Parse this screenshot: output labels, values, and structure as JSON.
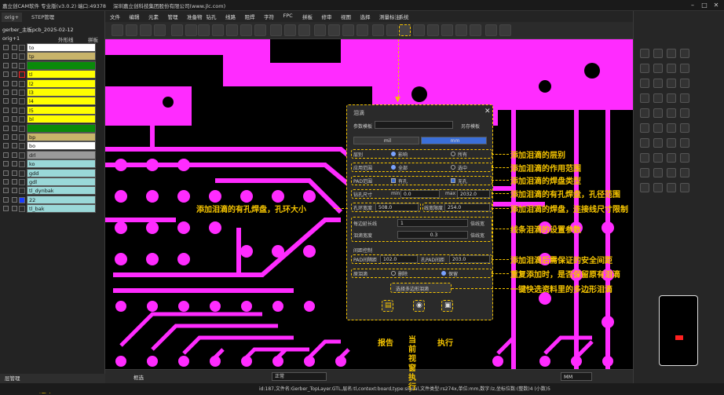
{
  "titlebar": {
    "app": "嘉立创CAM软件 专业版(v3.0.2) 端口:49378",
    "company": "深圳嘉立创科技集团股份有限公司(www.jlc.com)"
  },
  "left": {
    "tab1": "orig+",
    "tab2": "STEP管理",
    "project": "gerber_主板pcb_2025-02-12",
    "orig": "orig+1",
    "outline": "外形线",
    "panel": "拼板",
    "bottom_tab": "层管理",
    "selected": "选中:0",
    "layers": [
      {
        "name": "to",
        "color": "#ffffff"
      },
      {
        "name": "tp",
        "color": "#c8b46a"
      },
      {
        "name": "ts",
        "color": "#0a8a0a"
      },
      {
        "name": "tl",
        "color": "#ffff00"
      },
      {
        "name": "l2",
        "color": "#ffff00"
      },
      {
        "name": "l3",
        "color": "#ffff00"
      },
      {
        "name": "l4",
        "color": "#ffff00"
      },
      {
        "name": "l5",
        "color": "#ffff00"
      },
      {
        "name": "bl",
        "color": "#ffff00"
      },
      {
        "name": "bs",
        "color": "#0a8a0a"
      },
      {
        "name": "bp",
        "color": "#c8b46a"
      },
      {
        "name": "bo",
        "color": "#ffffff"
      },
      {
        "name": "drl",
        "color": "#9a9a9a"
      },
      {
        "name": "ko",
        "color": "#9ad8d8"
      },
      {
        "name": "gdd",
        "color": "#9ad8d8"
      },
      {
        "name": "gdl",
        "color": "#9ad8d8"
      },
      {
        "name": "tl_dynbak",
        "color": "#9ad8d8"
      },
      {
        "name": "22",
        "color": "#9ad8d8"
      },
      {
        "name": "tl_bak",
        "color": "#9ad8d8"
      }
    ]
  },
  "menu": [
    "文件",
    "编辑",
    "元素",
    "管理",
    "准备物",
    "钻孔",
    "线路",
    "阻焊",
    "字符",
    "FPC",
    "拼板",
    "修审",
    "视图",
    "选择",
    "测量标注",
    "系统"
  ],
  "dialog": {
    "title": "泪滴",
    "template_label": "参数模板",
    "save_template": "另存模板",
    "tab_mil": "mil",
    "tab_mm": "mm",
    "layer_label": "层别",
    "layer_cur": "影响",
    "layer_all": "所有",
    "scope_label": "应用范围",
    "scope_all": "全部",
    "scope_sel": "选中",
    "pad_label": "PAD范围",
    "pad_hole": "有孔",
    "pad_nohole": "无孔",
    "hole_label": "钻孔尺寸",
    "min_label": "min",
    "min_val": "0.0",
    "max_label": "max",
    "max_val": "2032.0",
    "ring_label": "孔环宽度",
    "ring_val": "508.0",
    "lw_label": "线宽限度",
    "lw_val": "254.0",
    "seg_label": "每边延长线",
    "seg_val": "1",
    "seg_unit": "倍线宽",
    "taper_label": "泪滴宽度",
    "taper_val": "0.3",
    "taper_unit": "倍线宽",
    "clear_title": "间距控制",
    "pad_clear": "PAD间隔距",
    "pad_clear_val": "102.0",
    "nonpad_clear": "孔PAD间距",
    "nonpad_clear_val": "203.0",
    "existing": "原泪滴",
    "delete": "删除",
    "keep": "保留",
    "poly_btn": "选择多边形泪滴"
  },
  "annotations": {
    "a1": "添加泪滴的层别",
    "a2": "添加泪滴的作用范围",
    "a3": "添加泪滴的焊盘类型",
    "a4": "添加泪滴的有孔焊盘，孔径范围",
    "a5": "添加泪滴的有孔焊盘，孔环大小",
    "a6": "添加泪滴的焊盘，连接线尺寸限制",
    "a7": "线条泪滴的设置参数",
    "a8": "添加泪滴后需保证的安全间距",
    "a9": "重复添加时，是否保留原有泪滴",
    "a10": "一键快选资料里的多边形泪滴",
    "b1": "报告",
    "b2": "当前视窗执行",
    "b3": "执行"
  },
  "bottom": {
    "mode": "框选",
    "units": "MM",
    "normal": "正常"
  },
  "status": "id:187,文件名:Gerber_TopLayer.GTL,层名:tl,context:board,type:signal,文件类型:rs274x,单位:mm,数字:lz,坐标位数:(整数)4 (小数)5",
  "colors": {
    "trace": "#ff2bff",
    "accent": "#f5c400",
    "bg": "#000000"
  }
}
